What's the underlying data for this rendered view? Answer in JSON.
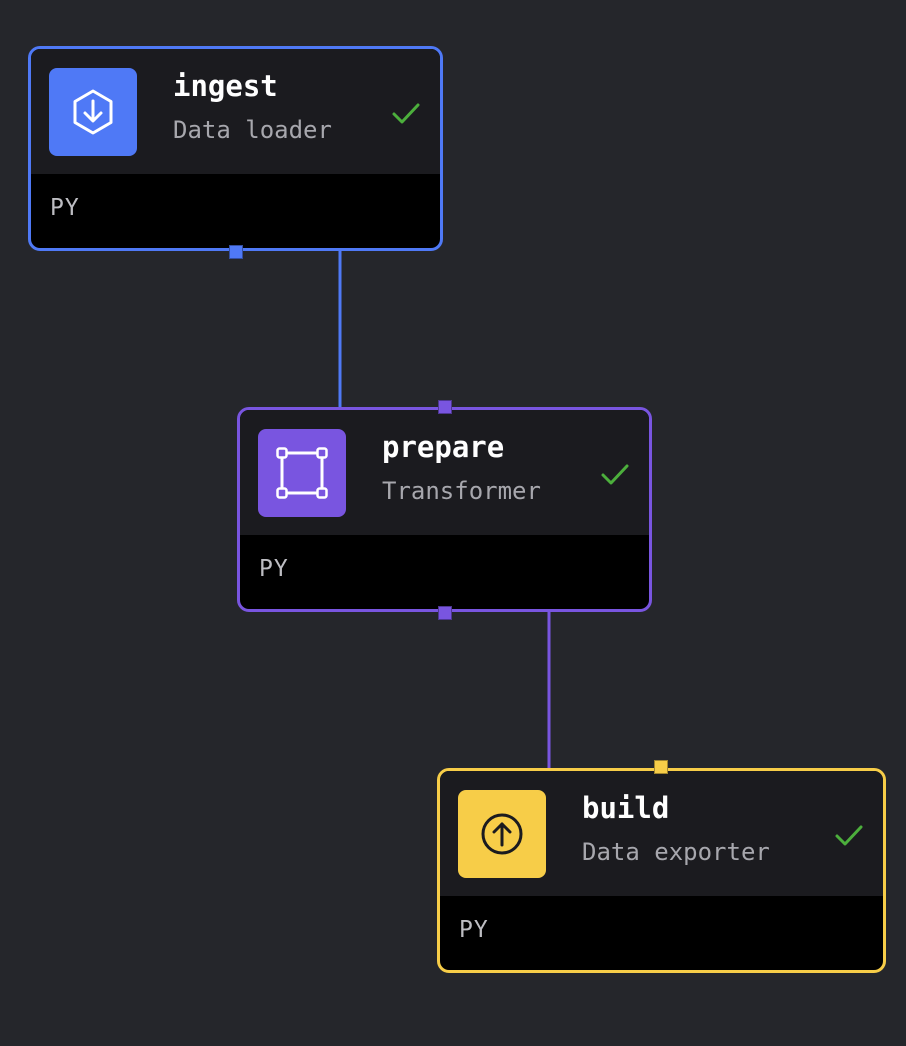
{
  "colors": {
    "canvas_background": "#25262b",
    "data_loader": "#4f79f6",
    "transformer": "#7955e0",
    "data_exporter": "#f7cd48",
    "success": "#4caf3c"
  },
  "pipeline": {
    "blocks": [
      {
        "name": "ingest",
        "type": "Data loader",
        "language": "PY",
        "icon": "download-icon",
        "status": "success",
        "status_icon": "checkmark-icon",
        "color": "#4f79f6"
      },
      {
        "name": "prepare",
        "type": "Transformer",
        "language": "PY",
        "icon": "transform-square-icon",
        "status": "success",
        "status_icon": "checkmark-icon",
        "color": "#7955e0"
      },
      {
        "name": "build",
        "type": "Data exporter",
        "language": "PY",
        "icon": "upload-icon",
        "status": "success",
        "status_icon": "checkmark-icon",
        "color": "#f7cd48"
      }
    ],
    "edges": [
      {
        "from": "ingest",
        "to": "prepare"
      },
      {
        "from": "prepare",
        "to": "build"
      }
    ]
  }
}
